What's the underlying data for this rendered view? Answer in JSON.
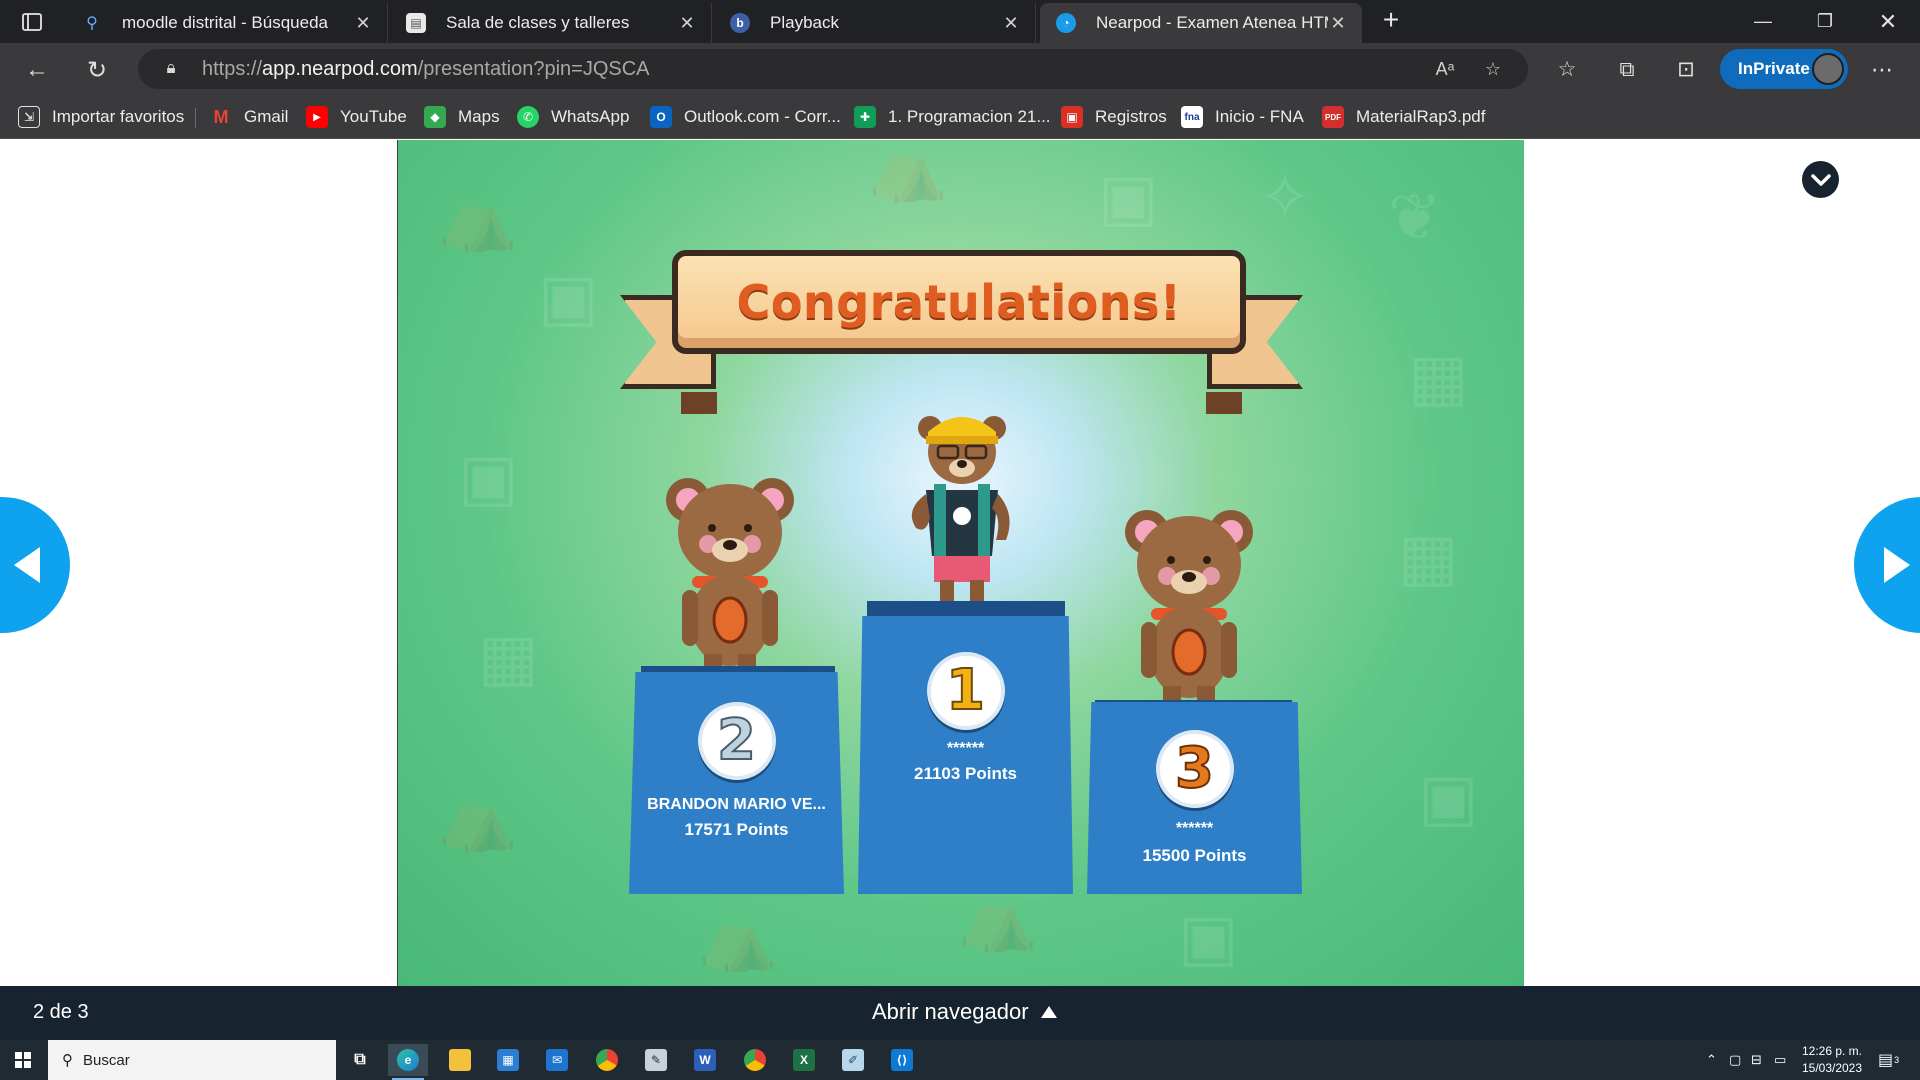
{
  "browser": {
    "tabs": [
      {
        "title": "moodle distrital - Búsqueda",
        "favicon": "search-icon",
        "active": false
      },
      {
        "title": "Sala de clases y talleres",
        "favicon": "document-icon",
        "active": false
      },
      {
        "title": "Playback",
        "favicon": "b-logo-icon",
        "active": false
      },
      {
        "title": "Nearpod - Examen Atenea HTML",
        "favicon": "nearpod-icon",
        "active": true
      }
    ],
    "url_prefix": "https://",
    "url_host": "app.nearpod.com",
    "url_path": "/presentation?pin=JQSCA",
    "inprivate_label": "InPrivate"
  },
  "favorites": [
    {
      "label": "Importar favoritos",
      "icon": "import-icon"
    },
    {
      "label": "Gmail",
      "icon": "gmail-icon"
    },
    {
      "label": "YouTube",
      "icon": "youtube-icon"
    },
    {
      "label": "Maps",
      "icon": "maps-icon"
    },
    {
      "label": "WhatsApp",
      "icon": "whatsapp-icon"
    },
    {
      "label": "Outlook.com - Corr...",
      "icon": "outlook-icon"
    },
    {
      "label": "1. Programacion 21...",
      "icon": "sheets-icon"
    },
    {
      "label": "Registros",
      "icon": "registros-icon"
    },
    {
      "label": "Inicio - FNA",
      "icon": "fna-icon"
    },
    {
      "label": "MaterialRap3.pdf",
      "icon": "pdf-icon"
    }
  ],
  "slide": {
    "banner": "Congratulations!",
    "podium": [
      {
        "place": "2",
        "name": "BRANDON MARIO VE...",
        "points": "17571 Points"
      },
      {
        "place": "1",
        "name": "******",
        "points": "21103 Points"
      },
      {
        "place": "3",
        "name": "******",
        "points": "15500 Points"
      }
    ]
  },
  "footer": {
    "counter": "2 de 3",
    "open_navigator": "Abrir navegador"
  },
  "taskbar": {
    "search_placeholder": "Buscar",
    "time": "12:26 p. m.",
    "date": "15/03/2023",
    "notification_count": "3"
  },
  "colors": {
    "accent_blue": "#0fa2ee",
    "podium_blue": "#2e7fc7",
    "stage_green": "#5ec787",
    "banner_text": "#e05d22",
    "footer_bg": "#17232e"
  }
}
